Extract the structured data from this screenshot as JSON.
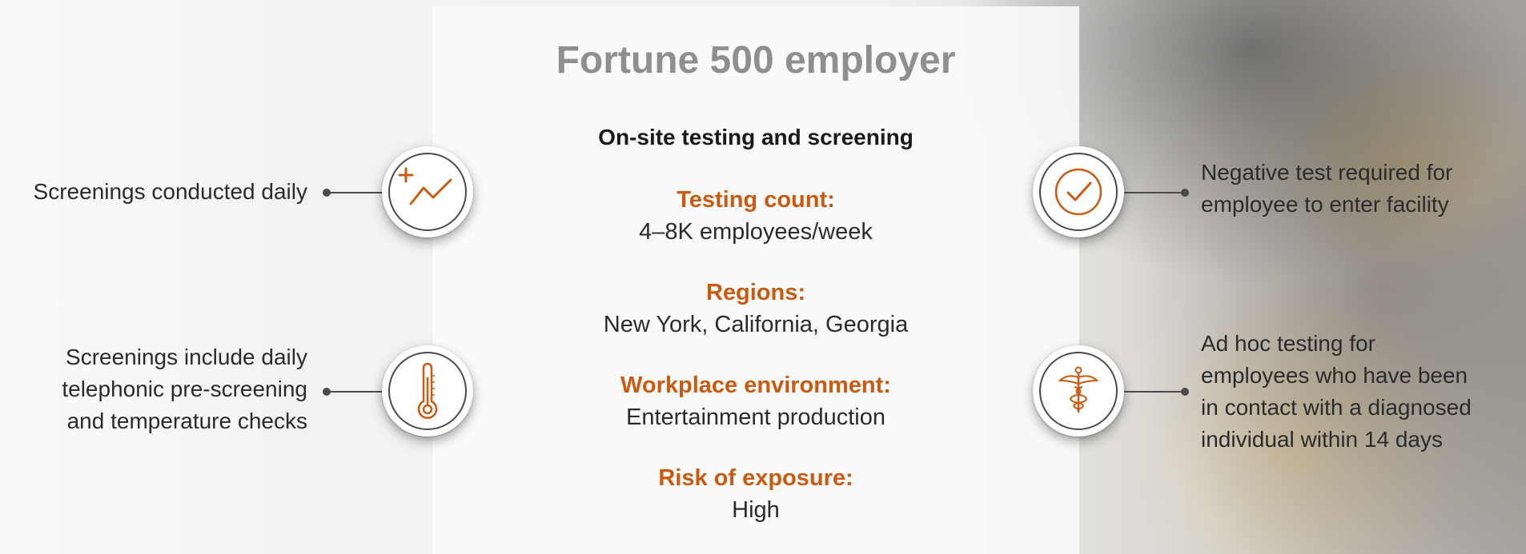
{
  "title": "Fortune 500 employer",
  "subtitle": "On-site testing and screening",
  "facts": [
    {
      "label": "Testing count:",
      "value": "4–8K employees/week"
    },
    {
      "label": "Regions:",
      "value": "New York, California, Georgia"
    },
    {
      "label": "Workplace environment:",
      "value": "Entertainment production"
    },
    {
      "label": "Risk of exposure:",
      "value": "High"
    }
  ],
  "left_items": [
    {
      "text": "Screenings conducted daily",
      "icon": "trend-chart-icon"
    },
    {
      "lines": [
        "Screenings include daily",
        "telephonic pre-screening",
        "and temperature checks"
      ],
      "icon": "thermometer-icon"
    }
  ],
  "right_items": [
    {
      "lines": [
        "Negative test required for",
        "employee to enter facility"
      ],
      "icon": "checkmark-icon"
    },
    {
      "lines": [
        "Ad hoc testing for",
        "employees who have been",
        "in contact with a diagnosed",
        "individual within 14 days"
      ],
      "icon": "caduceus-icon"
    }
  ],
  "colors": {
    "accent": "#c85a12",
    "title": "#8f8f8f",
    "text": "#2b2b2b",
    "connector": "#4a4a4a"
  }
}
